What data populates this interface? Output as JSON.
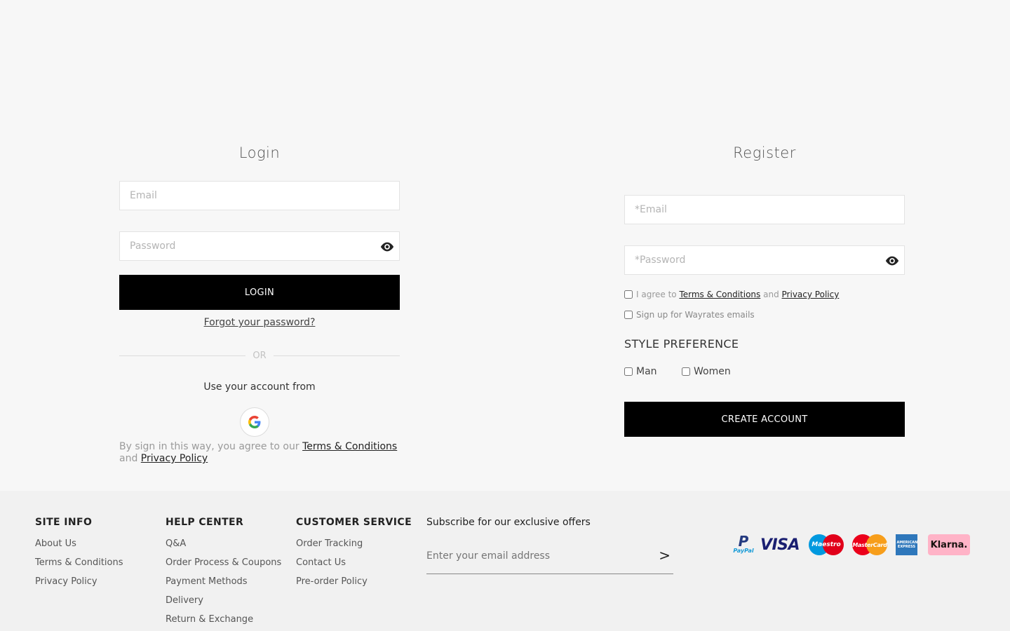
{
  "login": {
    "title": "Login",
    "email_placeholder": "Email",
    "password_placeholder": "Password",
    "login_button": "LOGIN",
    "forgot_link": "Forgot your password?",
    "or_text": "OR",
    "use_account_text": "Use your account from",
    "consent_prefix": "By sign in this way, you agree to our",
    "terms_link": "Terms & Conditions",
    "consent_and": "and",
    "privacy_link": "Privacy Policy"
  },
  "register": {
    "title": "Register",
    "email_placeholder": "*Email",
    "password_placeholder": "*Password",
    "agree_prefix": "I agree to",
    "terms_link": "Terms & Conditions",
    "agree_and": "and",
    "privacy_link": "Privacy Policy",
    "signup_emails": "Sign up for Wayrates emails",
    "style_heading": "STYLE PREFERENCE",
    "style_options": [
      "Man",
      "Women"
    ],
    "create_button": "CREATE ACCOUNT"
  },
  "footer": {
    "site_info": {
      "heading": "SITE INFO",
      "items": [
        "About Us",
        "Terms & Conditions",
        "Privacy Policy"
      ]
    },
    "help_center": {
      "heading": "HELP CENTER",
      "items": [
        "Q&A",
        "Order Process & Coupons",
        "Payment Methods",
        "Delivery",
        "Return & Exchange"
      ]
    },
    "customer_service": {
      "heading": "CUSTOMER SERVICE",
      "items": [
        "Order Tracking",
        "Contact Us",
        "Pre-order Policy"
      ]
    },
    "subscribe": {
      "heading": "Subscribe for our exclusive offers",
      "placeholder": "Enter your email address",
      "submit": ">"
    },
    "payments": {
      "paypal_top": "P",
      "paypal_text": "PayPal",
      "visa": "VISA",
      "maestro": "Maestro",
      "mastercard": "MasterCard",
      "amex": "AMERICAN EXPRESS",
      "klarna": "Klarna."
    }
  },
  "colors": {
    "background": "#f7f7f7",
    "footer_bg": "#f1f1f1",
    "button_bg": "#000000",
    "klarna_pink": "#ffb3c7",
    "visa_blue": "#1a1f71",
    "amex_blue": "#2e77bb"
  }
}
